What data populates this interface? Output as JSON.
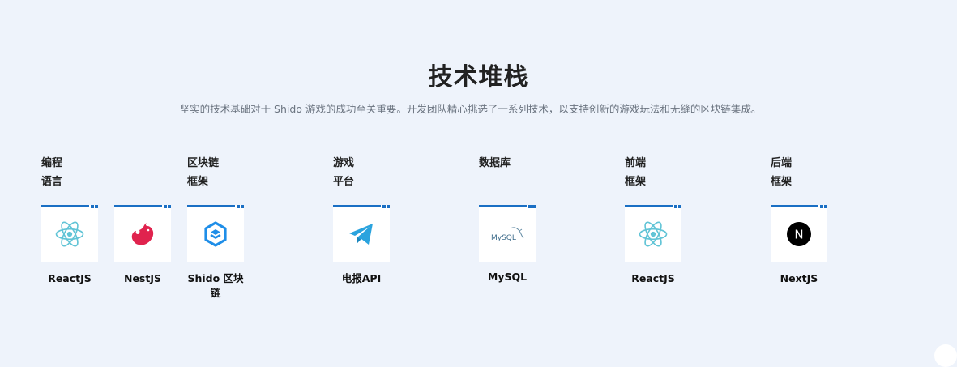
{
  "header": {
    "title": "技术堆栈",
    "subtitle": "坚实的技术基础对于 Shido 游戏的成功至关重要。开发团队精心挑选了一系列技术，以支持创新的游戏玩法和无缝的区块链集成。"
  },
  "categories": [
    {
      "line1": "编程",
      "line2": "语言"
    },
    {
      "line1": "区块链",
      "line2": "框架"
    },
    {
      "line1": "游戏",
      "line2": "平台"
    },
    {
      "line1": "数据库",
      "line2": ""
    },
    {
      "line1": "前端",
      "line2": "框架"
    },
    {
      "line1": "后端",
      "line2": "框架"
    }
  ],
  "tech": [
    {
      "label": "ReactJS",
      "icon": "react-icon"
    },
    {
      "label": "NestJS",
      "icon": "nestjs-icon"
    },
    {
      "label": "Shido 区块链",
      "icon": "shido-blockchain-icon"
    },
    {
      "label": "电报API",
      "icon": "telegram-icon"
    },
    {
      "label": "MySQL",
      "icon": "mysql-icon",
      "icon_text": "MySQL"
    },
    {
      "label": "ReactJS",
      "icon": "react-icon"
    },
    {
      "label": "NextJS",
      "icon": "nextjs-icon",
      "icon_text": "N"
    }
  ],
  "colors": {
    "background": "#eef3fb",
    "accent": "#1a6fc4",
    "react": "#61c4d6",
    "nest": "#e0234e",
    "telegram": "#2aa3de"
  }
}
